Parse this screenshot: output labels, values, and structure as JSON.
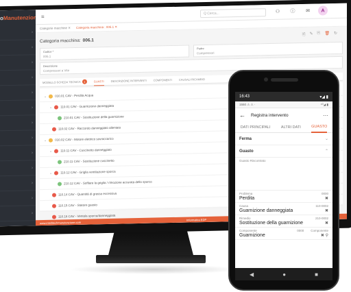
{
  "desktop": {
    "brand_left": "nteo",
    "brand_right": "Manutenzione",
    "sidebar_items": [
      "",
      "",
      "",
      "",
      "",
      "",
      "",
      "",
      "",
      "",
      "",
      "",
      "",
      ""
    ],
    "search_placeholder": "Q Cerca...",
    "avatar_letter": "A",
    "tabs": [
      "Categorie macchine ✕",
      "Categoria macchina : 006.1 ✕"
    ],
    "page_title_label": "Categoria macchina:",
    "page_title_value": "006.1",
    "fields": {
      "codice_label": "Codice *",
      "codice_value": "006.1",
      "padre_label": "Padre",
      "padre_value": "Compressori",
      "descrizione_label": "Descrizione",
      "descrizione_value": "Compressori a Vite"
    },
    "inner_tabs": [
      "MODELLO SCHEDA TECNICA",
      "GUASTI",
      "DESCRIZIONE INTERVENTI",
      "COMPONENTI",
      "CAUSALI RICAMBIO"
    ],
    "badge_count": "1",
    "tree": [
      {
        "caret": "⌄",
        "dot": "o",
        "text": "010.01 CAV - Perdita Acqua"
      },
      {
        "caret": "⌄",
        "dot": "r",
        "text": "110.01 CAV - Guarnizione danneggiata"
      },
      {
        "caret": "",
        "dot": "g",
        "text": "210.01 CAV - Sostituzione della guarnizione"
      },
      {
        "caret": "",
        "dot": "r",
        "text": "110.02 CAV - Raccordo danneggiato allentato"
      },
      {
        "caret": "⌄",
        "dot": "o",
        "text": "010.02 CAV - Motore elettrico sovraccarico"
      },
      {
        "caret": "⌄",
        "dot": "r",
        "text": "110.11 CAV - Cuscinetto danneggiato"
      },
      {
        "caret": "",
        "dot": "g",
        "text": "210.11 CAV - Sostituzione cuscinetto"
      },
      {
        "caret": "⌄",
        "dot": "r",
        "text": "110.12 CAV - Griglia ventilazione sporca"
      },
      {
        "caret": "",
        "dot": "g",
        "text": "210.12 CAV - Soffiare la griglia / rimozione accurata dello sporco"
      },
      {
        "caret": "",
        "dot": "r",
        "text": "110.14 CAV - Quantità di grasso eccessiva"
      },
      {
        "caret": "",
        "dot": "r",
        "text": "110.15 CAV - Statore guasto"
      },
      {
        "caret": "",
        "dot": "r",
        "text": "110.16 CAV - Ventola sporca/danneggiata"
      }
    ],
    "status_left": "www.intellitechmanutenzione.com",
    "status_mid": "Informatica EDP"
  },
  "phone": {
    "time": "16:43",
    "signal": "▾◢ ▮",
    "status2_left": "1550 ⚠ ⚠ ·",
    "status2_right": "⁴ᴳ◢ ▮",
    "title": "Registra intervento",
    "more": "⋯",
    "tabs": [
      "DATI PRINCIPALI",
      "ALTRI DATI",
      "GUASTO"
    ],
    "section_ferma": "Ferma",
    "section_guasto": "Guasto",
    "desc_label": "Guasto Riscontrato",
    "problema_label": "Problema",
    "problema_code": "0000",
    "problema_value": "Perdita",
    "causa_label": "Causa",
    "causa_code": "110-0002",
    "causa_value": "Guarnizione danneggiata",
    "rimedio_label": "Rimedio",
    "rimedio_code": "210-0002",
    "rimedio_value": "Sostituzione della guarnizione",
    "componente_label": "Componente",
    "componente_code": "0000",
    "componente_label2": "Componente",
    "componente_value": "Guarnizione",
    "nav": [
      "◀",
      "●",
      "■"
    ]
  }
}
